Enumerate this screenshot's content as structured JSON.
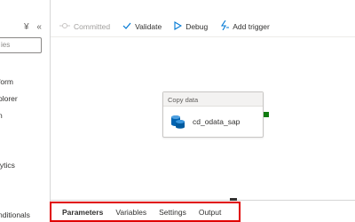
{
  "tab": {
    "close_glyph": "×"
  },
  "sidebar": {
    "collapse_glyphs": "¥ «",
    "search_placeholder": "ies",
    "items": [
      {
        "label": "form"
      },
      {
        "label": "plorer"
      },
      {
        "label": "n"
      },
      {
        "label": "lytics"
      },
      {
        "label": "nditionals"
      }
    ]
  },
  "toolbar": {
    "committed": "Committed",
    "validate": "Validate",
    "debug": "Debug",
    "add_trigger": "Add trigger"
  },
  "activity": {
    "header": "Copy data",
    "name": "cd_odata_sap"
  },
  "bottom_tabs": {
    "items": [
      "Parameters",
      "Variables",
      "Settings",
      "Output"
    ],
    "active": "Parameters"
  },
  "colors": {
    "accent": "#0078d4",
    "highlight_border": "#e00000",
    "success_handle": "#107c10"
  }
}
